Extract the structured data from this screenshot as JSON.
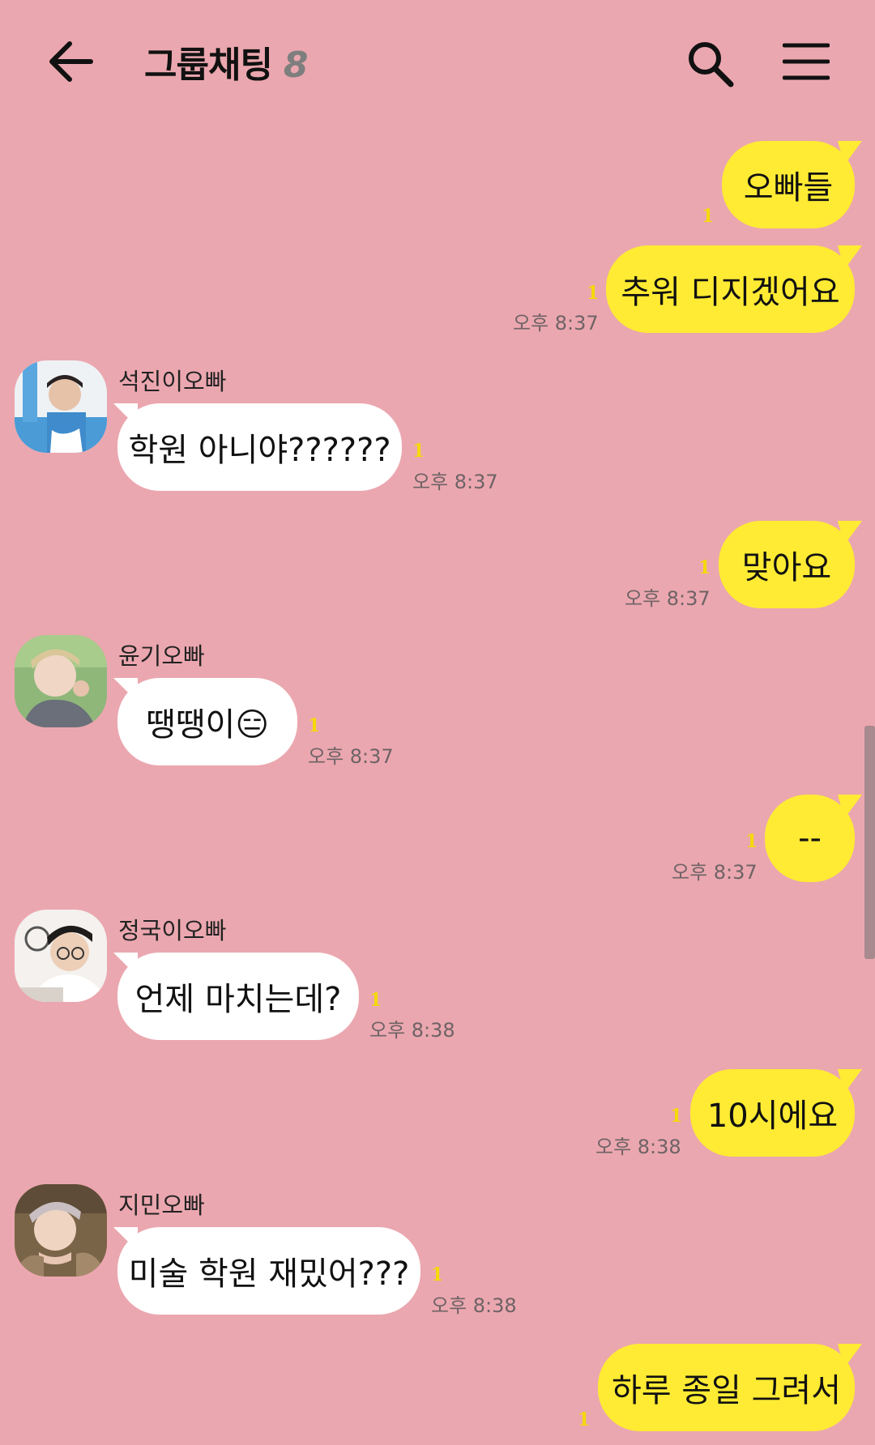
{
  "header": {
    "title": "그룹채팅",
    "member_count": "8",
    "back_icon": "arrow-left-icon",
    "search_icon": "search-icon",
    "menu_icon": "hamburger-menu-icon"
  },
  "colors": {
    "background": "#EBA7AF",
    "my_bubble": "#FFEB33",
    "other_bubble": "#FFFFFF",
    "unread": "#F5D90A"
  },
  "messages": [
    {
      "from": "me",
      "text": "오빠들",
      "unread": "1",
      "time": ""
    },
    {
      "from": "me",
      "text": "추워 디지겠어요",
      "unread": "1",
      "time": "오후 8:37"
    },
    {
      "from": "other",
      "sender": "석진이오빠",
      "text": "학원 아니야??????",
      "unread": "1",
      "time": "오후 8:37"
    },
    {
      "from": "me",
      "text": "맞아요",
      "unread": "1",
      "time": "오후 8:37"
    },
    {
      "from": "other",
      "sender": "윤기오빠",
      "text": "땡땡이😑",
      "unread": "1",
      "time": "오후 8:37"
    },
    {
      "from": "me",
      "text": "--",
      "unread": "1",
      "time": "오후 8:37"
    },
    {
      "from": "other",
      "sender": "정국이오빠",
      "text": "언제 마치는데?",
      "unread": "1",
      "time": "오후 8:38"
    },
    {
      "from": "me",
      "text": "10시에요",
      "unread": "1",
      "time": "오후 8:38"
    },
    {
      "from": "other",
      "sender": "지민오빠",
      "text": "미술 학원 재밌어???",
      "unread": "1",
      "time": "오후 8:38"
    },
    {
      "from": "me",
      "text": "하루 종일 그려서",
      "unread": "1",
      "time": ""
    }
  ]
}
